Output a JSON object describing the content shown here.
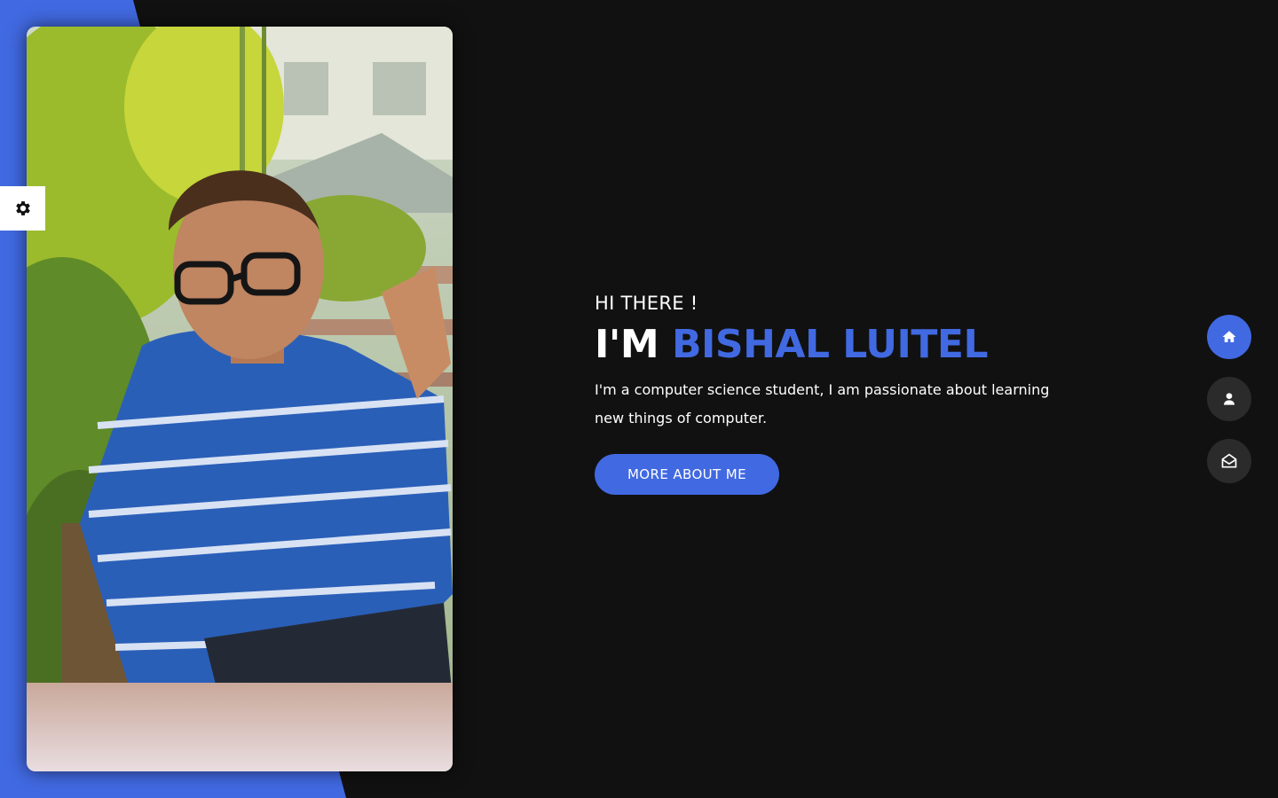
{
  "theme": {
    "accent": "#4169e1",
    "background": "#111111",
    "nav_inactive": "#2b2b2b"
  },
  "settings": {
    "icon": "gear-icon"
  },
  "hero": {
    "greeting": "HI THERE !",
    "headline_prefix": "I'M",
    "name": "BISHAL LUITEL",
    "bio": "I'm a computer science student, I am passionate about learning new things of computer.",
    "cta_label": "MORE ABOUT ME"
  },
  "nav": {
    "items": [
      {
        "icon": "home-icon",
        "active": true
      },
      {
        "icon": "user-icon",
        "active": false
      },
      {
        "icon": "envelope-open-icon",
        "active": false
      }
    ]
  }
}
